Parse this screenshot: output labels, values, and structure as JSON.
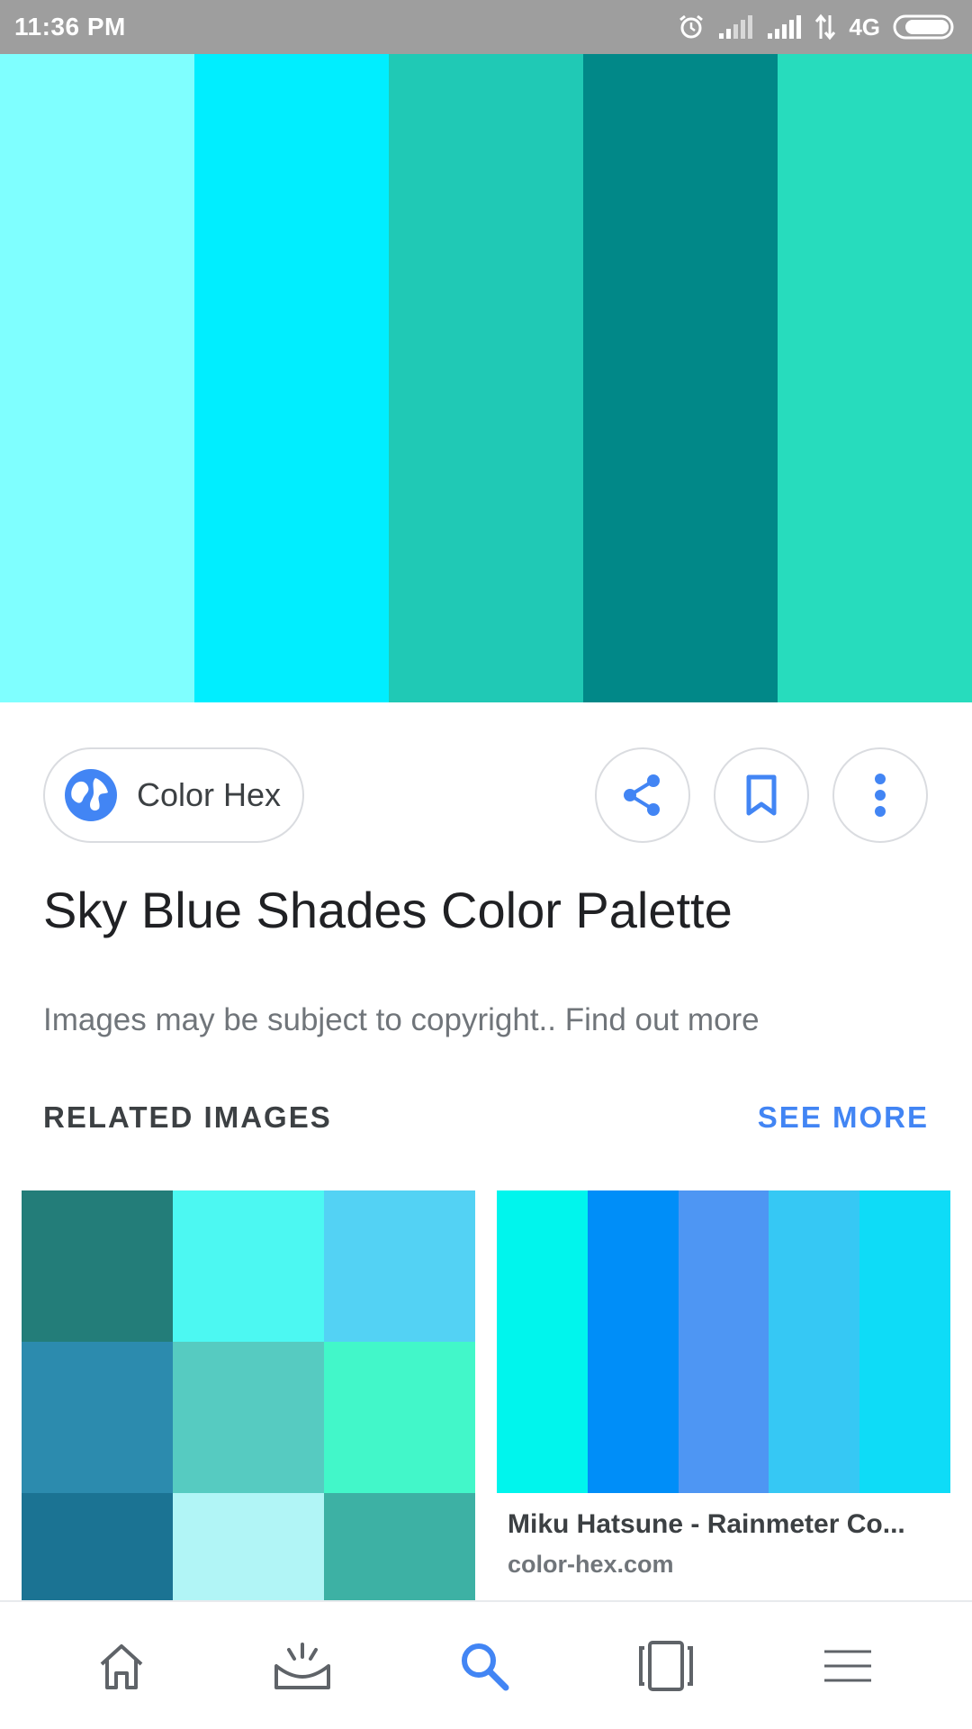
{
  "status_bar": {
    "time": "11:36 PM",
    "network": "4G",
    "icons": [
      "alarm-icon",
      "signal-icon",
      "signal-icon",
      "data-transfer-icon",
      "battery-icon"
    ]
  },
  "hero": {
    "colors": [
      "#7fffff",
      "#00eeff",
      "#20c9b5",
      "#018888",
      "#27dcbd"
    ]
  },
  "source": {
    "label": "Color Hex",
    "icon": "globe-icon"
  },
  "actions": {
    "icons": [
      "share-icon",
      "bookmark-icon",
      "more-vert-icon"
    ]
  },
  "title": "Sky Blue Shades Color Palette",
  "copyright": "Images may be subject to copyright.. Find out more",
  "related": {
    "heading": "RELATED IMAGES",
    "see_more": "SEE MORE",
    "items": [
      {
        "grid_colors": [
          "#237d79",
          "#4cf8f2",
          "#53d2f4",
          "#2c8bae",
          "#56cbc1",
          "#42f7c9",
          "#1b7393",
          "#b1f5f6",
          "#3db1a4"
        ]
      },
      {
        "colors": [
          "#00f5ed",
          "#008ef8",
          "#4e96f3",
          "#36c8f4",
          "#0edcf7"
        ],
        "caption": "Miku Hatsune - Rainmeter Co...",
        "domain": "color-hex.com"
      }
    ]
  },
  "bottom_nav": {
    "items": [
      "home-icon",
      "discover-icon",
      "search-icon",
      "collections-icon",
      "menu-icon"
    ],
    "active_color": "#4285f4",
    "inactive_color": "#5f6368"
  },
  "colors": {
    "accent": "#4285f4",
    "status_bar_bg": "#9e9e9e"
  }
}
